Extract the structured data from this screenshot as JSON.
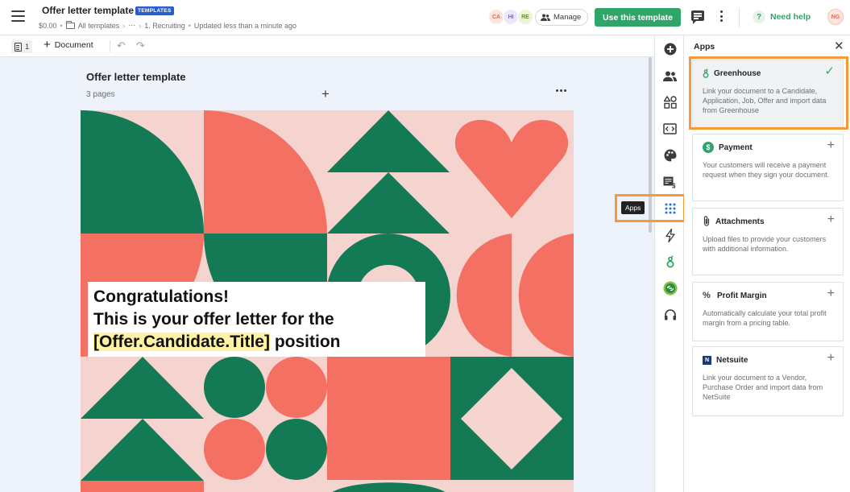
{
  "header": {
    "title": "Offer letter template",
    "badge": "TEMPLATES",
    "price": "$0.00",
    "breadcrumb": [
      "All templates",
      "⋯",
      "1. Recruiting"
    ],
    "updated": "Updated less than a minute ago",
    "avatars": [
      {
        "initials": "CA",
        "bg": "#fde6dd",
        "fg": "#e0694d"
      },
      {
        "initials": "HI",
        "bg": "#ece8fb",
        "fg": "#7a66d8"
      },
      {
        "initials": "RE",
        "bg": "#eaf4d9",
        "fg": "#6b8e2b"
      }
    ],
    "manage_label": "Manage",
    "use_template_label": "Use this template",
    "need_help_label": "Need help",
    "user_initials": "NG"
  },
  "toolbar": {
    "page_count": "1",
    "add_document_label": "Document"
  },
  "document": {
    "title": "Offer letter template",
    "pages_label": "3 pages",
    "text_line1": "Congratulations!",
    "text_line2": "This is your offer letter for the",
    "placeholder": "[Offer.Candidate.Title]",
    "text_line3_suffix": " position"
  },
  "rail": {
    "tooltip": "Apps",
    "icons": [
      "add-icon",
      "people-icon",
      "shapes-icon",
      "embed-icon",
      "palette-icon",
      "pricing-icon",
      "apps-grid-icon",
      "lightning-icon",
      "greenhouse-icon",
      "link-icon",
      "headset-icon"
    ]
  },
  "apps_panel": {
    "title": "Apps",
    "items": [
      {
        "name": "Greenhouse",
        "desc": "Link your document to a Candidate, Application, Job, Offer and import data from Greenhouse",
        "status": "added"
      },
      {
        "name": "Payment",
        "desc": "Your customers will receive a payment request when they sign your document.",
        "status": "available"
      },
      {
        "name": "Attachments",
        "desc": "Upload files to provide your customers with additional information.",
        "status": "available"
      },
      {
        "name": "Profit Margin",
        "desc": "Automatically calculate your total profit margin from a pricing table.",
        "status": "available"
      },
      {
        "name": "Netsuite",
        "desc": "Link your document to a Vendor, Purchase Order and import data from NetSuite",
        "status": "available"
      }
    ]
  },
  "colors": {
    "accent_green": "#2fa56a",
    "highlight_orange": "#f7993a",
    "pattern_green": "#147a55",
    "pattern_coral": "#f47063",
    "pattern_pink": "#f5d3cf"
  }
}
